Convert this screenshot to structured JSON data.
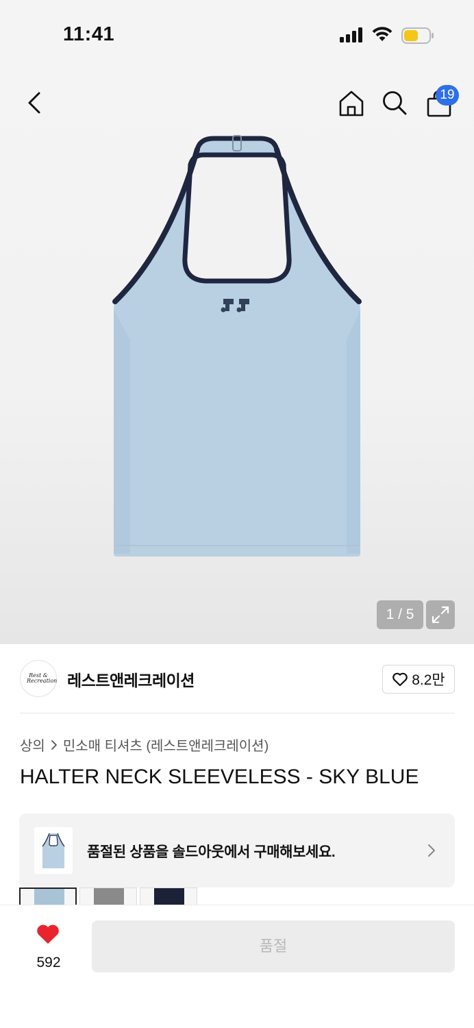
{
  "status_bar": {
    "time": "11:41",
    "signal_icon": "cellular-signal-icon",
    "wifi_icon": "wifi-icon",
    "battery_icon": "battery-icon",
    "battery_color": "#f5c518"
  },
  "header": {
    "back_icon": "chevron-left-icon",
    "home_icon": "home-icon",
    "search_icon": "search-icon",
    "cart_icon": "shopping-bag-icon",
    "cart_count": "19",
    "badge_color": "#2f6fe8"
  },
  "gallery": {
    "counter": "1 / 5",
    "expand_icon": "expand-icon",
    "product_colors": {
      "body": "#b8d0e2",
      "trim": "#1e2640"
    }
  },
  "brand": {
    "logo_text": "Rest & Recreation",
    "name": "레스트앤레크레이션",
    "like_icon": "heart-outline-icon",
    "like_count": "8.2만"
  },
  "breadcrumb": {
    "level1": "상의",
    "separator_icon": "chevron-right-icon",
    "level2": "민소매 티셔츠 (레스트앤레크레이션)"
  },
  "product": {
    "title": "HALTER NECK SLEEVELESS - SKY BLUE"
  },
  "soldout_banner": {
    "text": "품절된 상품을 솔드아웃에서 구매해보세요.",
    "arrow_icon": "chevron-right-icon"
  },
  "swatches": [
    {
      "color": "#a9c3d6"
    },
    {
      "color": "#8a8a8a"
    },
    {
      "color": "#1b2238"
    }
  ],
  "bottom_bar": {
    "heart_icon": "heart-filled-icon",
    "heart_color": "#e8242c",
    "like_count": "592",
    "purchase_label": "품절"
  }
}
